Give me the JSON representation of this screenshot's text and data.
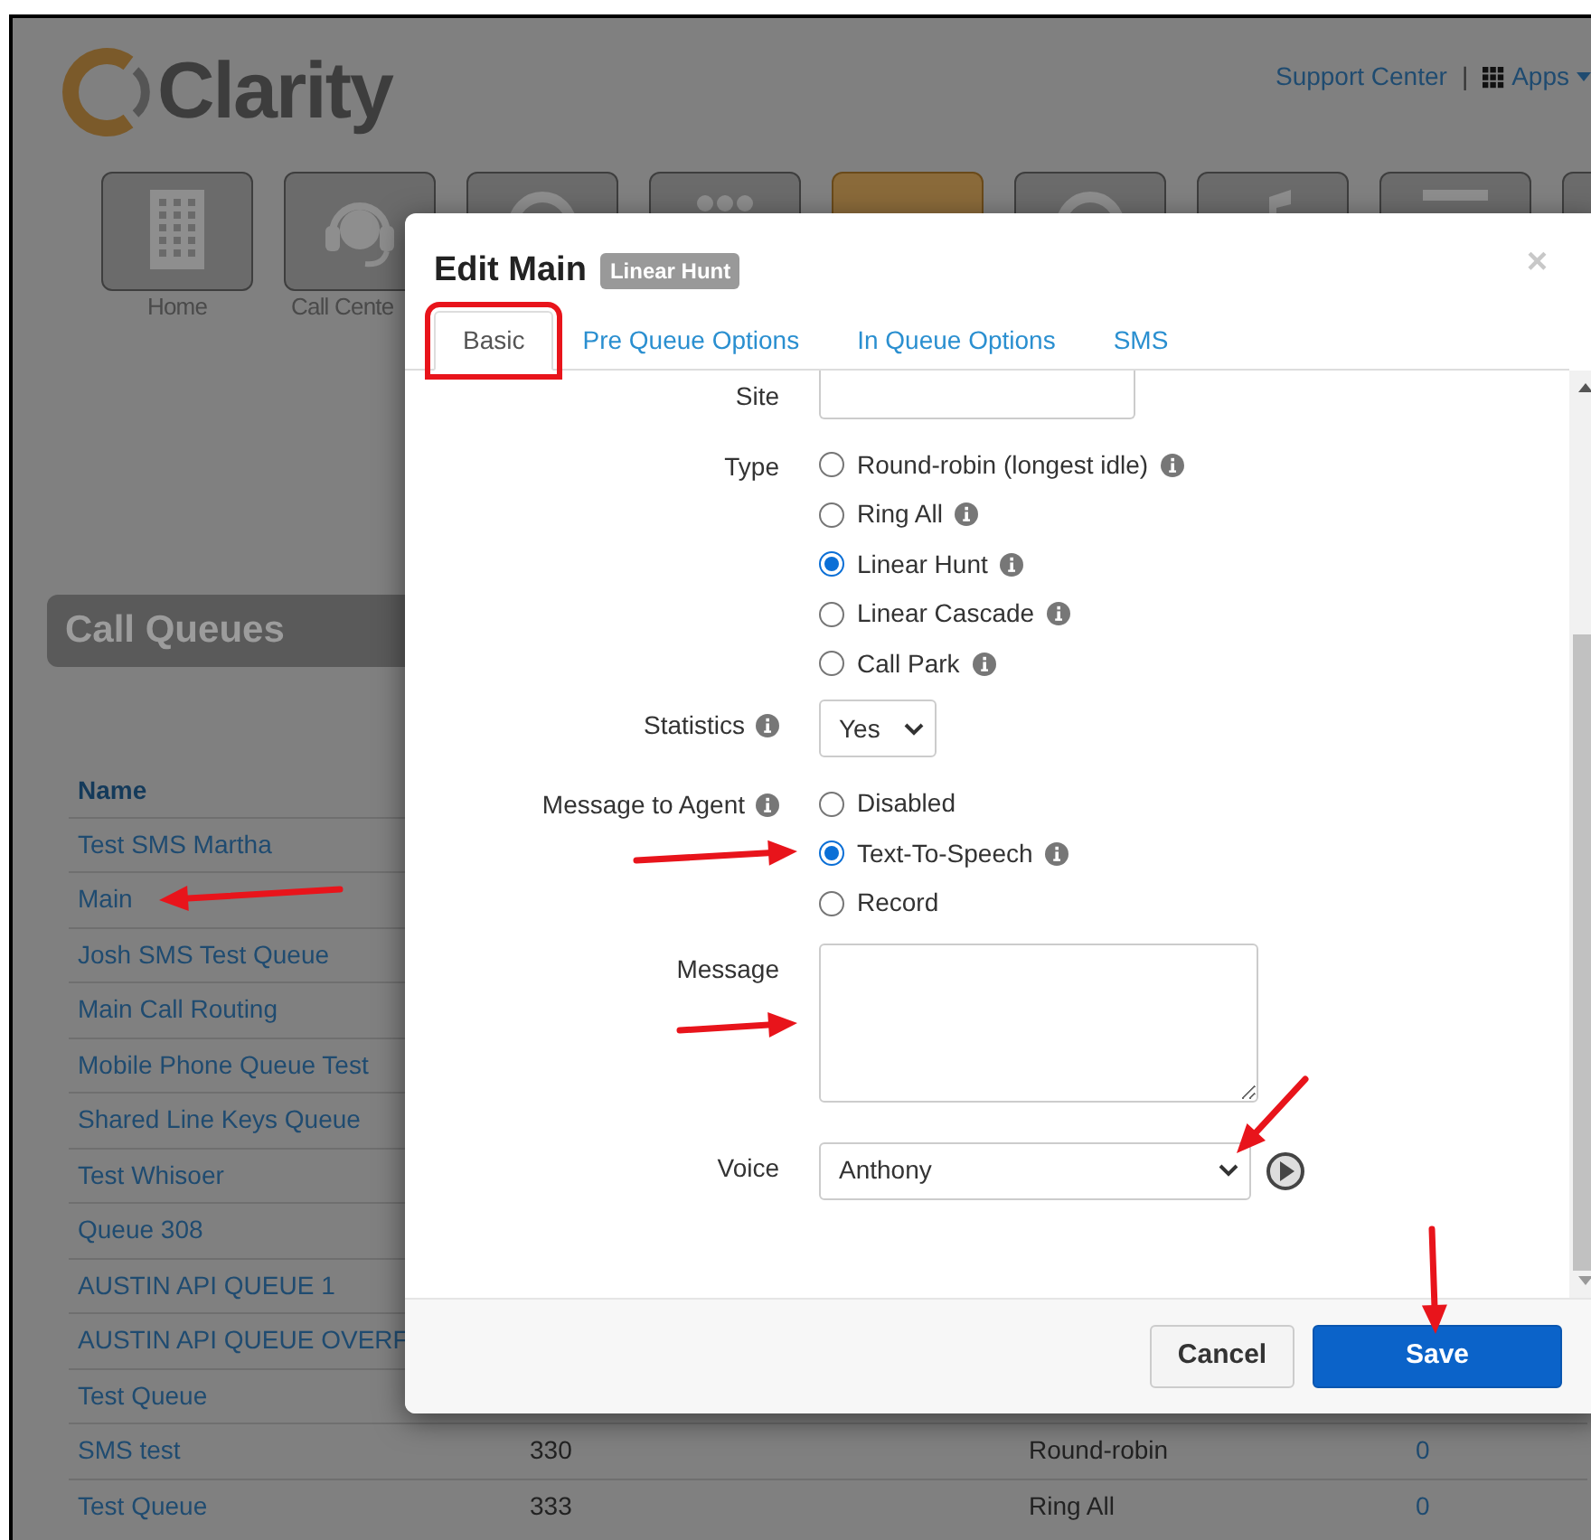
{
  "header": {
    "logo": "Clarity",
    "support_link": "Support Center",
    "separator": "|",
    "apps_menu": "Apps"
  },
  "nav_tiles": [
    {
      "label": "Home",
      "kind": "building",
      "selected": false
    },
    {
      "label": "Call Cente",
      "kind": "headset",
      "selected": false
    },
    {
      "kind": "ring",
      "selected": false
    },
    {
      "kind": "dots",
      "selected": false
    },
    {
      "kind": "blank",
      "selected": true
    },
    {
      "kind": "ring",
      "selected": false
    },
    {
      "kind": "note",
      "selected": false
    },
    {
      "kind": "bar",
      "selected": false
    },
    {
      "kind": "blank",
      "selected": false
    }
  ],
  "page_title": "Call Queues",
  "table": {
    "columns": [
      "Name"
    ],
    "rows": [
      {
        "name": "Test SMS Martha"
      },
      {
        "name": "Main"
      },
      {
        "name": "Josh SMS Test Queue"
      },
      {
        "name": "Main Call Routing"
      },
      {
        "name": "Mobile Phone Queue Test"
      },
      {
        "name": "Shared Line Keys Queue"
      },
      {
        "name": "Test Whisoer"
      },
      {
        "name": "Queue 308"
      },
      {
        "name": "AUSTIN API QUEUE 1"
      },
      {
        "name": "AUSTIN API QUEUE OVERF"
      },
      {
        "name": "Test Queue"
      },
      {
        "name": "SMS test",
        "column_2": "330",
        "column_3": "Round-robin",
        "column_4": "0"
      },
      {
        "name": "Test Queue",
        "column_2": "333",
        "column_3": "Ring All",
        "column_4": "0"
      }
    ]
  },
  "dialog": {
    "title": "Edit Main",
    "badge": "Linear Hunt",
    "close": "×",
    "tabs": [
      {
        "label": "Basic",
        "selected": true
      },
      {
        "label": "Pre Queue Options",
        "selected": false
      },
      {
        "label": "In Queue Options",
        "selected": false
      },
      {
        "label": "SMS",
        "selected": false
      }
    ],
    "fields": [
      {
        "kind": "text",
        "label": "Site"
      },
      {
        "kind": "radio",
        "label": "Type",
        "info": false,
        "options": [
          {
            "label": "Round-robin (longest idle)",
            "info": true,
            "selected": false
          },
          {
            "label": "Ring All",
            "info": true,
            "selected": false
          },
          {
            "label": "Linear Hunt",
            "info": true,
            "selected": true
          },
          {
            "label": "Linear Cascade",
            "info": true,
            "selected": false
          },
          {
            "label": "Call Park",
            "info": true,
            "selected": false
          }
        ]
      },
      {
        "kind": "select",
        "label": "Statistics",
        "info": true,
        "value": "Yes",
        "play_button": false
      },
      {
        "kind": "radio",
        "label": "Message to Agent",
        "info": true,
        "options": [
          {
            "label": "Disabled",
            "info": false,
            "selected": false
          },
          {
            "label": "Text-To-Speech",
            "info": true,
            "selected": true
          },
          {
            "label": "Record",
            "info": false,
            "selected": false
          }
        ]
      },
      {
        "kind": "textarea",
        "label": "Message"
      },
      {
        "kind": "select",
        "label": "Voice",
        "info": false,
        "value": "Anthony",
        "play_button": true
      }
    ],
    "buttons": [
      {
        "label": "Cancel",
        "kind": "secondary"
      },
      {
        "label": "Save",
        "kind": "primary"
      }
    ]
  }
}
